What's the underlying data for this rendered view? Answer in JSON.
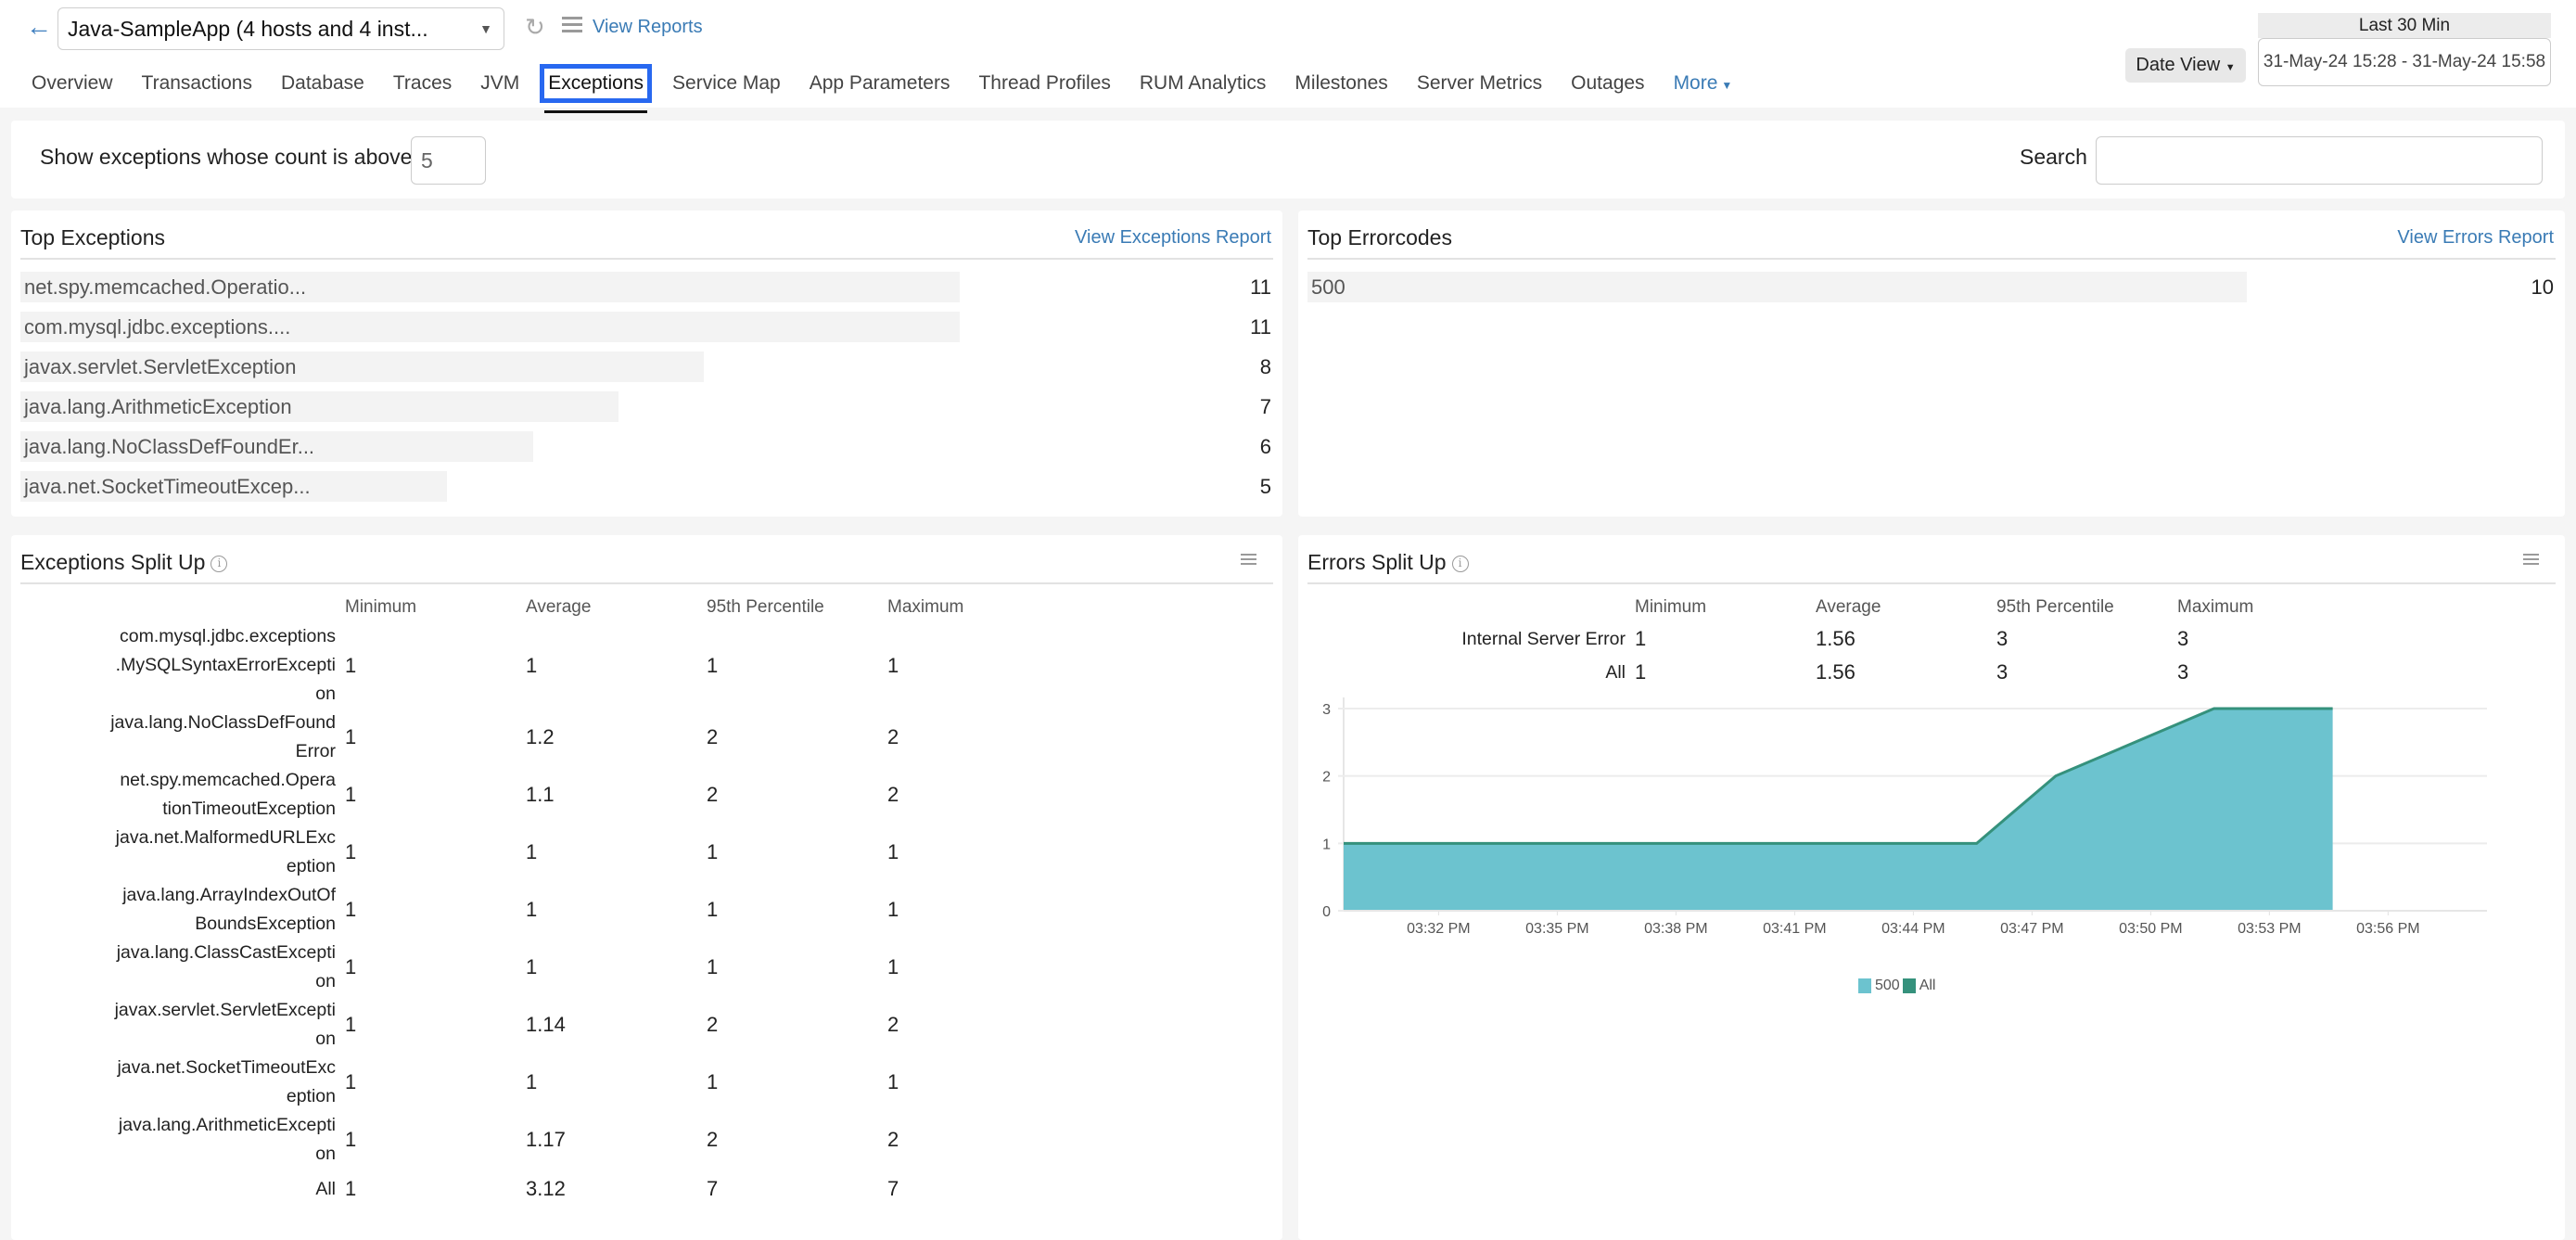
{
  "header": {
    "app_selector": "Java-SampleApp (4 hosts and 4 inst...",
    "view_reports": "View Reports",
    "date_view": "Date View",
    "time_preset": "Last 30 Min",
    "date_range": "31-May-24 15:28 - 31-May-24 15:58",
    "icons": {
      "back": "arrow-left-icon",
      "refresh": "refresh-icon",
      "menu": "hamburger-menu-icon"
    }
  },
  "tabs": [
    {
      "label": "Overview",
      "active": false
    },
    {
      "label": "Transactions",
      "active": false
    },
    {
      "label": "Database",
      "active": false
    },
    {
      "label": "Traces",
      "active": false
    },
    {
      "label": "JVM",
      "active": false
    },
    {
      "label": "Exceptions",
      "active": true
    },
    {
      "label": "Service Map",
      "active": false
    },
    {
      "label": "App Parameters",
      "active": false
    },
    {
      "label": "Thread Profiles",
      "active": false
    },
    {
      "label": "RUM Analytics",
      "active": false
    },
    {
      "label": "Milestones",
      "active": false
    },
    {
      "label": "Server Metrics",
      "active": false
    },
    {
      "label": "Outages",
      "active": false
    },
    {
      "label": "More",
      "active": false
    }
  ],
  "filter": {
    "label": "Show exceptions whose count is above",
    "count_value": "5",
    "search_label": "Search",
    "search_value": ""
  },
  "top_exceptions": {
    "title": "Top Exceptions",
    "link": "View Exceptions Report",
    "max": 11,
    "items": [
      {
        "name": "net.spy.memcached.Operatio...",
        "count": 11
      },
      {
        "name": "com.mysql.jdbc.exceptions....",
        "count": 11
      },
      {
        "name": "javax.servlet.ServletException",
        "count": 8
      },
      {
        "name": "java.lang.ArithmeticException",
        "count": 7
      },
      {
        "name": "java.lang.NoClassDefFoundEr...",
        "count": 6
      },
      {
        "name": "java.net.SocketTimeoutExcep...",
        "count": 5
      }
    ]
  },
  "top_errorcodes": {
    "title": "Top Errorcodes",
    "link": "View Errors Report",
    "max": 10,
    "items": [
      {
        "name": "500",
        "count": 10
      }
    ]
  },
  "exceptions_split": {
    "title": "Exceptions Split Up",
    "columns": [
      "Minimum",
      "Average",
      "95th Percentile",
      "Maximum"
    ],
    "rows": [
      {
        "label": [
          "com.mysql.jdbc.exceptions",
          ".MySQLSyntaxErrorExcepti",
          "on"
        ],
        "values": [
          "1",
          "1",
          "1",
          "1"
        ]
      },
      {
        "label": [
          "java.lang.NoClassDefFound",
          "Error"
        ],
        "values": [
          "1",
          "1.2",
          "2",
          "2"
        ]
      },
      {
        "label": [
          "net.spy.memcached.Opera",
          "tionTimeoutException"
        ],
        "values": [
          "1",
          "1.1",
          "2",
          "2"
        ]
      },
      {
        "label": [
          "java.net.MalformedURLExc",
          "eption"
        ],
        "values": [
          "1",
          "1",
          "1",
          "1"
        ]
      },
      {
        "label": [
          "java.lang.ArrayIndexOutOf",
          "BoundsException"
        ],
        "values": [
          "1",
          "1",
          "1",
          "1"
        ]
      },
      {
        "label": [
          "java.lang.ClassCastExcepti",
          "on"
        ],
        "values": [
          "1",
          "1",
          "1",
          "1"
        ]
      },
      {
        "label": [
          "javax.servlet.ServletExcepti",
          "on"
        ],
        "values": [
          "1",
          "1.14",
          "2",
          "2"
        ]
      },
      {
        "label": [
          "java.net.SocketTimeoutExc",
          "eption"
        ],
        "values": [
          "1",
          "1",
          "1",
          "1"
        ]
      },
      {
        "label": [
          "java.lang.ArithmeticExcepti",
          "on"
        ],
        "values": [
          "1",
          "1.17",
          "2",
          "2"
        ]
      },
      {
        "label": [
          "All"
        ],
        "values": [
          "1",
          "3.12",
          "7",
          "7"
        ]
      }
    ]
  },
  "errors_split": {
    "title": "Errors Split Up",
    "columns": [
      "Minimum",
      "Average",
      "95th Percentile",
      "Maximum"
    ],
    "rows": [
      {
        "label": [
          "Internal Server Error"
        ],
        "values": [
          "1",
          "1.56",
          "3",
          "3"
        ]
      },
      {
        "label": [
          "All"
        ],
        "values": [
          "1",
          "1.56",
          "3",
          "3"
        ]
      }
    ]
  },
  "chart_data": {
    "type": "area",
    "title": "Errors Split Up",
    "xlabel": "",
    "ylabel": "",
    "x_unit": "minutes past 03:00 PM",
    "xlim": [
      29.6,
      58.5
    ],
    "ylim": [
      0,
      3
    ],
    "yticks": [
      0,
      1,
      2,
      3
    ],
    "xticks": [
      {
        "value": 32,
        "label": "03:32 PM"
      },
      {
        "value": 35,
        "label": "03:35 PM"
      },
      {
        "value": 38,
        "label": "03:38 PM"
      },
      {
        "value": 41,
        "label": "03:41 PM"
      },
      {
        "value": 44,
        "label": "03:44 PM"
      },
      {
        "value": 47,
        "label": "03:47 PM"
      },
      {
        "value": 50,
        "label": "03:50 PM"
      },
      {
        "value": 53,
        "label": "03:53 PM"
      },
      {
        "value": 56,
        "label": "03:56 PM"
      }
    ],
    "grid": true,
    "legend_position": "bottom-center",
    "series": [
      {
        "name": "500",
        "color": "#6cc3cf",
        "x": [
          29.6,
          45.6,
          47.6,
          51.6,
          54.6
        ],
        "values": [
          1,
          1,
          2,
          3,
          3
        ]
      },
      {
        "name": "All",
        "color": "#35917c",
        "x": [
          29.6,
          45.6,
          47.6,
          51.6,
          54.6
        ],
        "values": [
          1,
          1,
          2,
          3,
          3
        ]
      }
    ]
  },
  "colors": {
    "accent": "#3a7bb5",
    "active_tab_outline": "#2868f0",
    "bar_bg": "#f3f3f3",
    "area_fill": "#6cc3cf",
    "line": "#35917c"
  }
}
